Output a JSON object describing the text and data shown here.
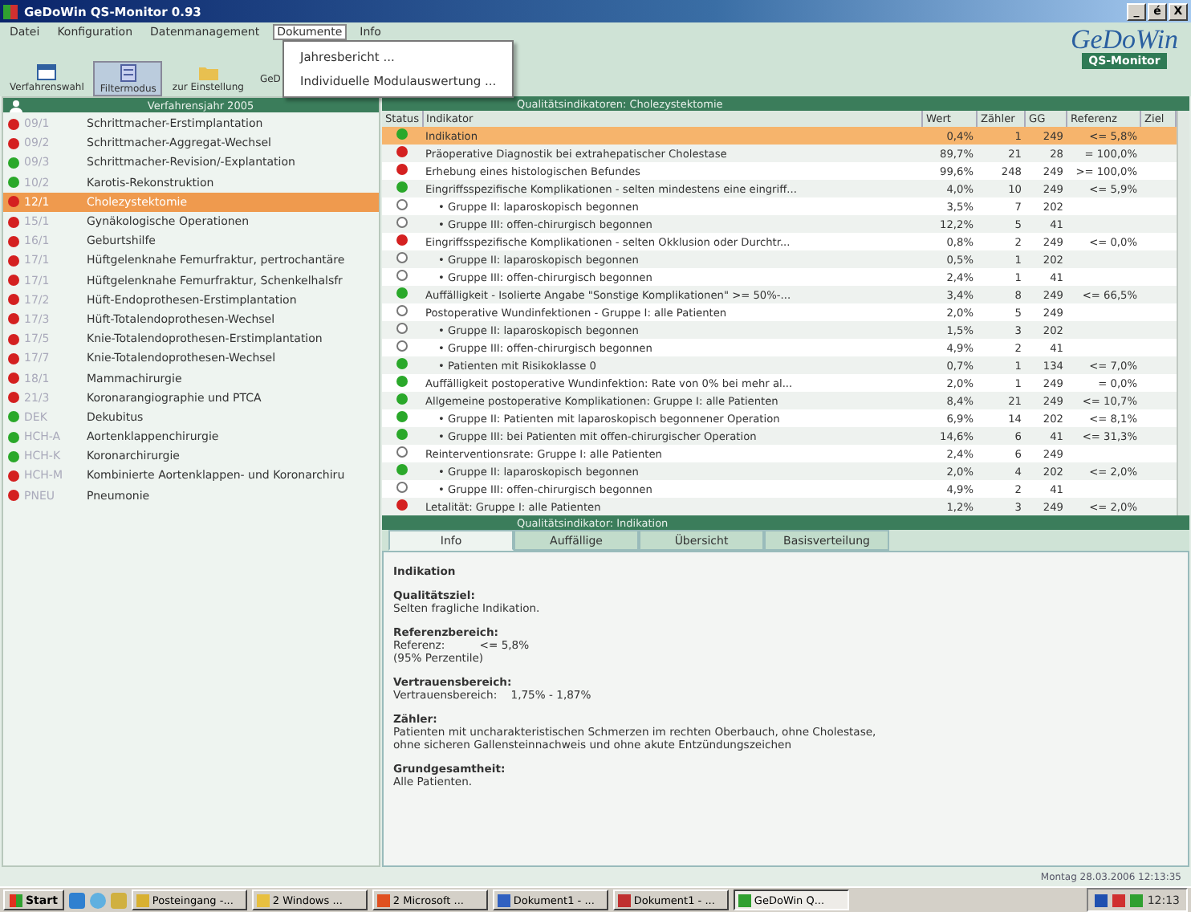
{
  "window": {
    "title": "GeDoWin QS-Monitor 0.93",
    "controls": [
      "_",
      "é",
      "X"
    ]
  },
  "menu": [
    {
      "label": "Datei",
      "open": false
    },
    {
      "label": "Konfiguration",
      "open": false
    },
    {
      "label": "Datenmanagement",
      "open": false
    },
    {
      "label": "Dokumente",
      "open": true
    },
    {
      "label": "Info",
      "open": false
    }
  ],
  "dropdown": [
    "Jahresbericht ...",
    "Individuelle Modulauswertung ..."
  ],
  "toolbar": [
    {
      "label": "Verfahrenswahl",
      "kind": "calendar"
    },
    {
      "label": "Filtermodus",
      "kind": "doc"
    },
    {
      "label": "zur Einstellung",
      "kind": "folder"
    },
    {
      "label": "GeD",
      "kind": "none"
    }
  ],
  "logo": {
    "name": "GeDoWin",
    "sub": "QS-Monitor"
  },
  "sidebar": {
    "title": "Verfahrensjahr 2005",
    "items": [
      {
        "code": "09/1",
        "name": "Schrittmacher-Erstimplantation",
        "color": "#d42020",
        "selected": false
      },
      {
        "code": "09/2",
        "name": "Schrittmacher-Aggregat-Wechsel",
        "color": "#d42020",
        "selected": false
      },
      {
        "code": "09/3",
        "name": "Schrittmacher-Revision/-Explantation",
        "color": "#2aa82a",
        "selected": false
      },
      {
        "code": "10/2",
        "name": "Karotis-Rekonstruktion",
        "color": "#2aa82a",
        "selected": false
      },
      {
        "code": "12/1",
        "name": "Cholezystektomie",
        "color": "#d42020",
        "selected": true
      },
      {
        "code": "15/1",
        "name": "Gynäkologische Operationen",
        "color": "#d42020",
        "selected": false
      },
      {
        "code": "16/1",
        "name": "Geburtshilfe",
        "color": "#d42020",
        "selected": false
      },
      {
        "code": "17/1",
        "name": "Hüftgelenknahe Femurfraktur, pertrochantäre",
        "color": "#d42020",
        "selected": false
      },
      {
        "code": "17/1",
        "name": "Hüftgelenknahe Femurfraktur, Schenkelhalsfr",
        "color": "#d42020",
        "selected": false
      },
      {
        "code": "17/2",
        "name": "Hüft-Endoprothesen-Erstimplantation",
        "color": "#d42020",
        "selected": false
      },
      {
        "code": "17/3",
        "name": "Hüft-Totalendoprothesen-Wechsel",
        "color": "#d42020",
        "selected": false
      },
      {
        "code": "17/5",
        "name": "Knie-Totalendoprothesen-Erstimplantation",
        "color": "#d42020",
        "selected": false
      },
      {
        "code": "17/7",
        "name": "Knie-Totalendoprothesen-Wechsel",
        "color": "#d42020",
        "selected": false
      },
      {
        "code": "18/1",
        "name": "Mammachirurgie",
        "color": "#d42020",
        "selected": false
      },
      {
        "code": "21/3",
        "name": "Koronarangiographie und PTCA",
        "color": "#d42020",
        "selected": false
      },
      {
        "code": "DEK",
        "name": "Dekubitus",
        "color": "#2aa82a",
        "selected": false
      },
      {
        "code": "HCH-A",
        "name": "Aortenklappenchirurgie",
        "color": "#2aa82a",
        "selected": false
      },
      {
        "code": "HCH-K",
        "name": "Koronarchirurgie",
        "color": "#2aa82a",
        "selected": false
      },
      {
        "code": "HCH-M",
        "name": "Kombinierte Aortenklappen- und Koronarchiru",
        "color": "#d42020",
        "selected": false
      },
      {
        "code": "PNEU",
        "name": "Pneumonie",
        "color": "#d42020",
        "selected": false
      }
    ]
  },
  "table": {
    "title": "Qualitätsindikatoren: Cholezystektomie",
    "columns": [
      "Status",
      "Indikator",
      "Wert",
      "Zähler",
      "GG",
      "Referenz",
      "Ziel"
    ],
    "rows": [
      {
        "color": "#2aa82a",
        "indicator": "Indikation",
        "wert": "0,4%",
        "zaehler": "1",
        "gg": "249",
        "referenz": "<= 5,8%",
        "selected": true
      },
      {
        "color": "#d42020",
        "indicator": "Präoperative Diagnostik bei extrahepatischer Cholestase",
        "wert": "89,7%",
        "zaehler": "21",
        "gg": "28",
        "referenz": "= 100,0%",
        "selected": false
      },
      {
        "color": "#d42020",
        "indicator": "Erhebung eines histologischen Befundes",
        "wert": "99,6%",
        "zaehler": "248",
        "gg": "249",
        "referenz": ">= 100,0%",
        "selected": false
      },
      {
        "color": "#2aa82a",
        "indicator": "Eingriffsspezifische Komplikationen - selten mindestens eine eingriff...",
        "wert": "4,0%",
        "zaehler": "10",
        "gg": "249",
        "referenz": "<= 5,9%",
        "selected": false,
        "children": [
          {
            "indicator": "• Gruppe II: laparoskopisch begonnen",
            "wert": "3,5%",
            "zaehler": "7",
            "gg": "202",
            "selected": false
          },
          {
            "indicator": "• Gruppe III: offen-chirurgisch begonnen",
            "wert": "12,2%",
            "zaehler": "5",
            "gg": "41",
            "selected": false
          }
        ]
      },
      {
        "color": "#d42020",
        "indicator": "Eingriffsspezifische Komplikationen - selten Okklusion oder Durchtr...",
        "wert": "0,8%",
        "zaehler": "2",
        "gg": "249",
        "referenz": "<= 0,0%",
        "selected": false,
        "children": [
          {
            "indicator": "• Gruppe II: laparoskopisch begonnen",
            "wert": "0,5%",
            "zaehler": "1",
            "gg": "202",
            "selected": false
          },
          {
            "indicator": "• Gruppe III: offen-chirurgisch begonnen",
            "wert": "2,4%",
            "zaehler": "1",
            "gg": "41",
            "selected": false
          }
        ]
      },
      {
        "color": "#2aa82a",
        "indicator": "Auffälligkeit - Isolierte Angabe \"Sonstige Komplikationen\" >= 50%-...",
        "wert": "3,4%",
        "zaehler": "8",
        "gg": "249",
        "referenz": "<= 66,5%",
        "selected": false
      },
      {
        "indicator": "Postoperative Wundinfektionen - Gruppe I: alle Patienten",
        "wert": "2,0%",
        "zaehler": "5",
        "gg": "249",
        "selected": false,
        "children": [
          {
            "indicator": "• Gruppe II: laparoskopisch begonnen",
            "wert": "1,5%",
            "zaehler": "3",
            "gg": "202",
            "selected": false
          },
          {
            "indicator": "• Gruppe III: offen-chirurgisch begonnen",
            "wert": "4,9%",
            "zaehler": "2",
            "gg": "41",
            "selected": false
          },
          {
            "color": "#2aa82a",
            "indicator": "• Patienten mit Risikoklasse 0",
            "wert": "0,7%",
            "zaehler": "1",
            "gg": "134",
            "referenz": "<= 7,0%",
            "selected": false
          }
        ]
      },
      {
        "color": "#2aa82a",
        "indicator": "Auffälligkeit postoperative Wundinfektion: Rate von 0% bei mehr al...",
        "wert": "2,0%",
        "zaehler": "1",
        "gg": "249",
        "referenz": "= 0,0%",
        "selected": false
      },
      {
        "color": "#2aa82a",
        "indicator": "Allgemeine postoperative Komplikationen: Gruppe I: alle Patienten",
        "wert": "8,4%",
        "zaehler": "21",
        "gg": "249",
        "referenz": "<= 10,7%",
        "selected": false,
        "children": [
          {
            "color": "#2aa82a",
            "indicator": "• Gruppe II: Patienten mit laparoskopisch begonnener Operation",
            "wert": "6,9%",
            "zaehler": "14",
            "gg": "202",
            "referenz": "<= 8,1%",
            "selected": false
          },
          {
            "color": "#2aa82a",
            "indicator": "• Gruppe III: bei Patienten mit offen-chirurgischer Operation",
            "wert": "14,6%",
            "zaehler": "6",
            "gg": "41",
            "referenz": "<= 31,3%",
            "selected": false
          }
        ]
      },
      {
        "indicator": "Reinterventionsrate: Gruppe I: alle Patienten",
        "wert": "2,4%",
        "zaehler": "6",
        "gg": "249",
        "selected": false,
        "children": [
          {
            "color": "#2aa82a",
            "indicator": "• Gruppe II: laparoskopisch begonnen",
            "wert": "2,0%",
            "zaehler": "4",
            "gg": "202",
            "referenz": "<= 2,0%",
            "selected": false
          },
          {
            "indicator": "• Gruppe III: offen-chirurgisch begonnen",
            "wert": "4,9%",
            "zaehler": "2",
            "gg": "41",
            "selected": false
          }
        ]
      },
      {
        "color": "#d42020",
        "indicator": "Letalität: Gruppe I: alle Patienten",
        "wert": "1,2%",
        "zaehler": "3",
        "gg": "249",
        "referenz": "<= 2,0%",
        "selected": false
      }
    ]
  },
  "detail": {
    "title": "Qualitätsindikator: Indikation",
    "tabs": [
      {
        "label": "Info",
        "selected": true
      },
      {
        "label": "Auffällige",
        "selected": false
      },
      {
        "label": "Übersicht",
        "selected": false
      },
      {
        "label": "Basisverteilung",
        "selected": false
      }
    ],
    "heading": "Indikation",
    "sections": [
      {
        "label": "Qualitätsziel:",
        "lines": [
          "Selten fragliche Indikation."
        ]
      },
      {
        "label": "Referenzbereich:",
        "lines": [
          "Referenz:          <= 5,8%",
          "(95% Perzentile)"
        ]
      },
      {
        "label": "Vertrauensbereich:",
        "lines": [
          "Vertrauensbereich:    1,75% - 1,87%"
        ]
      },
      {
        "label": "Zähler:",
        "lines": [
          "Patienten mit uncharakteristischen Schmerzen im rechten Oberbauch, ohne Cholestase,",
          "ohne sicheren Gallensteinnachweis und ohne akute Entzündungszeichen"
        ]
      },
      {
        "label": "Grundgesamtheit:",
        "lines": [
          "Alle Patienten."
        ]
      }
    ]
  },
  "status_bar": "Montag 28.03.2006 12:13:35",
  "taskbar": {
    "start": "Start",
    "tasks": [
      {
        "label": "Posteingang -...",
        "selected": false
      },
      {
        "label": "2 Windows ...",
        "selected": false
      },
      {
        "label": "2 Microsoft ...",
        "selected": false
      },
      {
        "label": "Dokument1 - ...",
        "selected": false
      },
      {
        "label": "Dokument1 - ...",
        "selected": false
      },
      {
        "label": "GeDoWin Q...",
        "selected": true
      }
    ],
    "clock": "12:13"
  }
}
